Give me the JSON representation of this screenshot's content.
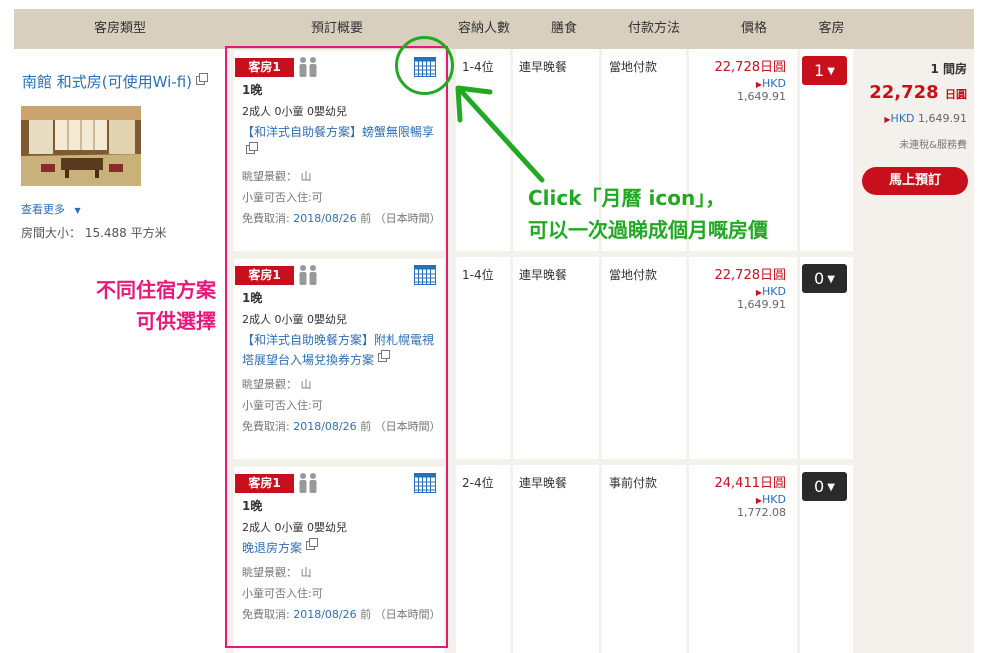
{
  "header": {
    "room_type": "客房類型",
    "summary": "預訂概要",
    "capacity": "容納人數",
    "meal": "膳食",
    "payment": "付款方法",
    "price": "價格",
    "rooms": "客房"
  },
  "room": {
    "name": "南館 和式房(可使用Wi-fi)",
    "see_more": "查看更多",
    "size": "房間大小： 15.488 平方米"
  },
  "plans": [
    {
      "tag": "客房1",
      "nights": "1晚",
      "guests": "2成人 0小童 0嬰幼兒",
      "plan_name": "【和洋式自助餐方案】螃蟹無限暢享",
      "view": "眺望景觀： 山",
      "children": "小童可否入住:可",
      "cancel_label": "免費取消: ",
      "cancel_date": "2018/08/26",
      "cancel_suffix": " 前 （日本時間）",
      "capacity": "1-4位",
      "meal": "連早晚餐",
      "payment": "當地付款",
      "price_jpy": "22,728日圓",
      "hkd_currency": "HKD",
      "price_hkd": "1,649.91",
      "qty": "1"
    },
    {
      "tag": "客房1",
      "nights": "1晚",
      "guests": "2成人 0小童 0嬰幼兒",
      "plan_name": "【和洋式自助晚餐方案】附札幌電視塔展望台入場兌換券方案",
      "view": "眺望景觀： 山",
      "children": "小童可否入住:可",
      "cancel_label": "免費取消: ",
      "cancel_date": "2018/08/26",
      "cancel_suffix": " 前 （日本時間）",
      "capacity": "1-4位",
      "meal": "連早晚餐",
      "payment": "當地付款",
      "price_jpy": "22,728日圓",
      "hkd_currency": "HKD",
      "price_hkd": "1,649.91",
      "qty": "0"
    },
    {
      "tag": "客房1",
      "nights": "1晚",
      "guests": "2成人 0小童 0嬰幼兒",
      "plan_name": "晚退房方案",
      "view": "眺望景觀： 山",
      "children": "小童可否入住:可",
      "cancel_label": "免費取消: ",
      "cancel_date": "2018/08/26",
      "cancel_suffix": " 前 （日本時間）",
      "capacity": "2-4位",
      "meal": "連早晚餐",
      "payment": "事前付款",
      "price_jpy": "24,411日圓",
      "hkd_currency": "HKD",
      "price_hkd": "1,772.08",
      "qty": "0"
    }
  ],
  "summary_panel": {
    "rooms": "1 間房",
    "total_jpy": "22,728",
    "total_unit": "日圓",
    "hkd_currency": "HKD",
    "total_hkd": "1,649.91",
    "tax_note": "未連稅&服務費",
    "book_button": "馬上預訂"
  },
  "annotations": {
    "pink_line1": "不同住宿方案",
    "pink_line2": "可供選擇",
    "green_line1": "Click「月曆 icon」，",
    "green_line2": "可以一次過睇成個月嘅房價"
  },
  "colors": {
    "accent_red": "#c8101c",
    "link_blue": "#2d6fb5",
    "annotation_pink": "#e6197a",
    "annotation_green": "#22a822",
    "header_beige": "#d8cfbe"
  },
  "icons": [
    "external-link-icon",
    "people-icon",
    "calendar-icon",
    "chevron-down-icon"
  ]
}
